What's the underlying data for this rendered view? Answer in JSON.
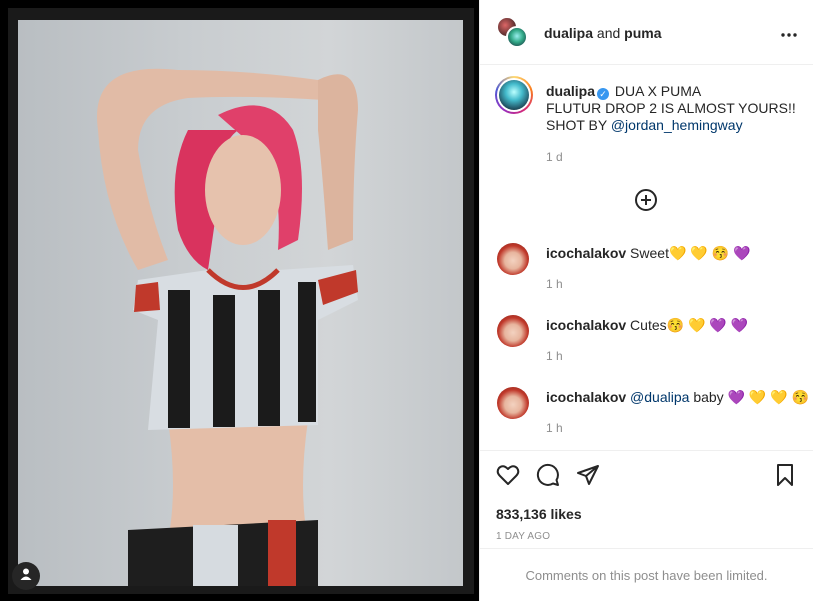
{
  "post": {
    "header": {
      "owner": "dualipa",
      "connector": "and",
      "collaborator": "puma"
    },
    "caption": {
      "username": "dualipa",
      "line1": "DUA X PUMA",
      "line2": "FLUTUR DROP 2 IS ALMOST YOURS!!",
      "line3_prefix": "SHOT BY",
      "mention": "@jordan_hemingway",
      "time": "1 d"
    },
    "comments": [
      {
        "username": "icochalakov",
        "text": "Sweet",
        "emojis": [
          "💛",
          "💛",
          "😚",
          "💜"
        ],
        "time": "1 h"
      },
      {
        "username": "icochalakov",
        "text": "Cutes",
        "emojis": [
          "😚",
          "💛",
          "💜",
          "💜"
        ],
        "time": "1 h"
      },
      {
        "username": "icochalakov",
        "mention": "@dualipa",
        "text": "baby",
        "emojis": [
          "💜",
          "💛",
          "💛",
          "😚"
        ],
        "time": "1 h"
      }
    ],
    "likes": "833,136 likes",
    "posted_ago": "1 DAY AGO",
    "comments_limited": "Comments on this post have been limited."
  },
  "icons": {
    "more": "more-options-icon",
    "load_more": "plus-circle-icon",
    "like": "heart-icon",
    "comment": "comment-bubble-icon",
    "share": "paper-plane-icon",
    "save": "bookmark-icon",
    "tag": "user-tag-icon",
    "verified": "verified-badge-icon"
  },
  "colors": {
    "link": "#00376b",
    "muted": "#8e8e8e",
    "verified": "#3897f0"
  }
}
